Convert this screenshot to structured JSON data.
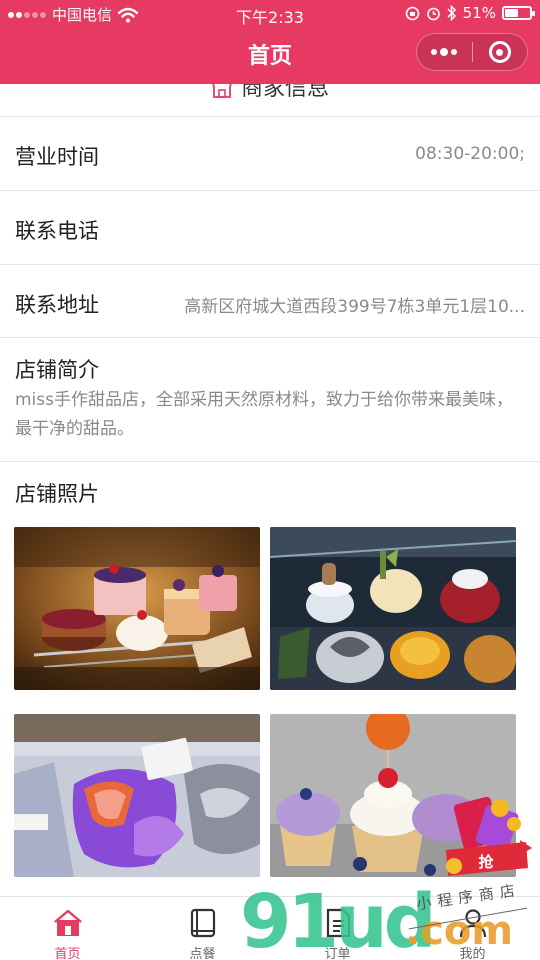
{
  "status_bar": {
    "carrier": "中国电信",
    "time": "下午2:33",
    "battery": "51%",
    "battery_level": 0.51
  },
  "nav": {
    "title": "首页",
    "more_icon": "more-dots-icon",
    "close_icon": "target-icon"
  },
  "section": {
    "title": "商家信息",
    "icon": "store-icon"
  },
  "info": {
    "hours_label": "营业时间",
    "hours_value": "08:30-20:00;",
    "phone_label": "联系电话",
    "phone_value": "",
    "address_label": "联系地址",
    "address_value": "高新区府城大道西段399号7栋3单元1层10...",
    "intro_label": "店铺简介",
    "intro_text": "miss手作甜品店，全部采用天然原材料，致力于给你带来最美味，最干净的甜品。",
    "photos_label": "店铺照片"
  },
  "photos": [
    "cakes-on-rack",
    "cake-display-case",
    "gelato-display",
    "cupcakes"
  ],
  "floating": {
    "label": "抢",
    "icon": "red-envelope-icon"
  },
  "tabbar": {
    "items": [
      {
        "label": "首页",
        "icon": "home-icon",
        "active": true
      },
      {
        "label": "点餐",
        "icon": "menu-book-icon",
        "active": false
      },
      {
        "label": "订单",
        "icon": "order-icon",
        "active": false
      },
      {
        "label": "我的",
        "icon": "user-icon",
        "active": false
      }
    ]
  },
  "watermark": {
    "num": "91ud",
    "com": ".com",
    "text": "小程序商店"
  },
  "colors": {
    "primary": "#e63a62",
    "text_muted": "#8a8a8a"
  }
}
